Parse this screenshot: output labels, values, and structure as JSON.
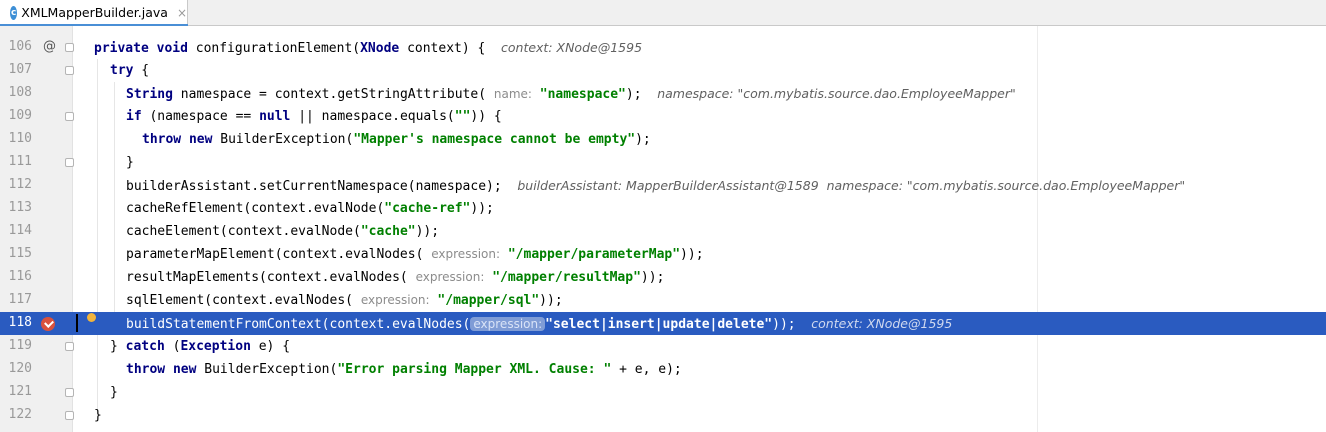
{
  "tab": {
    "icon_letter": "c",
    "filename": "XMLMapperBuilder.java",
    "close": "×"
  },
  "colors": {
    "selection": "#2a5bc0",
    "keyword": "#000080",
    "string": "#008000",
    "breakpoint": "#d9523e"
  },
  "lines": [
    {
      "no": "106"
    },
    {
      "no": "107"
    },
    {
      "no": "108"
    },
    {
      "no": "109"
    },
    {
      "no": "110"
    },
    {
      "no": "111"
    },
    {
      "no": "112"
    },
    {
      "no": "113"
    },
    {
      "no": "114"
    },
    {
      "no": "115"
    },
    {
      "no": "116"
    },
    {
      "no": "117"
    },
    {
      "no": "118"
    },
    {
      "no": "119"
    },
    {
      "no": "120"
    },
    {
      "no": "121"
    },
    {
      "no": "122"
    }
  ],
  "code": {
    "l106": {
      "kw": "private void",
      "name": " configurationElement(",
      "type": "XNode",
      "rest": " context) {",
      "hint": "context: XNode@1595"
    },
    "l107": {
      "kw": "try",
      "rest": " {"
    },
    "l108": {
      "type": "String",
      "rest": " namespace = context.getStringAttribute(",
      "hint_name": "name:",
      "str": "\"namespace\"",
      "end": ");",
      "hint": "namespace: \"com.mybatis.source.dao.EmployeeMapper\""
    },
    "l109": {
      "kw": "if",
      "pre": " (namespace == ",
      "kw2": "null",
      "mid": " || namespace.equals(",
      "str": "\"\"",
      "end": ")) {"
    },
    "l110": {
      "kw": "throw new",
      "rest": " BuilderException(",
      "str": "\"Mapper's namespace cannot be empty\"",
      "end": ");"
    },
    "l111": {
      "rest": "}"
    },
    "l112": {
      "rest": "builderAssistant.setCurrentNamespace(namespace);",
      "hint": "builderAssistant: MapperBuilderAssistant@1589  namespace: \"com.mybatis.source.dao.EmployeeMapper\""
    },
    "l113": {
      "rest": "cacheRefElement(context.evalNode(",
      "str": "\"cache-ref\"",
      "end": "));"
    },
    "l114": {
      "rest": "cacheElement(context.evalNode(",
      "str": "\"cache\"",
      "end": "));"
    },
    "l115": {
      "rest": "parameterMapElement(context.evalNodes(",
      "hint_name": "expression:",
      "str": "\"/mapper/parameterMap\"",
      "end": "));"
    },
    "l116": {
      "rest": "resultMapElements(context.evalNodes(",
      "hint_name": "expression:",
      "str": "\"/mapper/resultMap\"",
      "end": "));"
    },
    "l117": {
      "rest": "sqlElement(context.evalNodes(",
      "hint_name": "expression:",
      "str": "\"/mapper/sql\"",
      "end": "));"
    },
    "l118": {
      "rest": "buildStatementFromContext(context.evalNodes(",
      "hint_name": "expression:",
      "str": "\"select|insert|update|delete\"",
      "end": "));",
      "hint": "context: XNode@1595"
    },
    "l119": {
      "pre": "} ",
      "kw": "catch",
      "mid": " (",
      "type": "Exception",
      "end": " e) {"
    },
    "l120": {
      "kw": "throw new",
      "rest": " BuilderException(",
      "str": "\"Error parsing Mapper XML. Cause: \"",
      "end": " + e, e);"
    },
    "l121": {
      "rest": "}"
    },
    "l122": {
      "rest": "}"
    }
  },
  "gutter_marks": {
    "override": "@"
  }
}
